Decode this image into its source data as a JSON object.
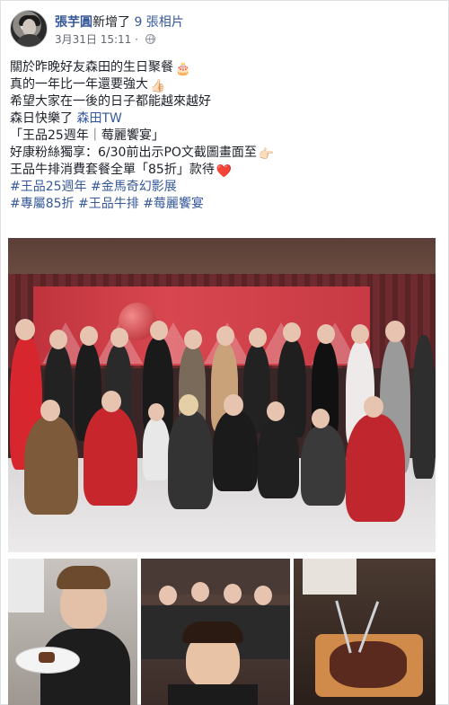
{
  "post": {
    "author": "張芋圓",
    "action": "新增了",
    "photo_count": "9 張相片",
    "timestamp": "3月31日 15:11",
    "separator": "·",
    "privacy_icon": "globe-icon"
  },
  "content": {
    "line1": "關於昨晚好友森田的生日聚餐",
    "line1_emoji": "🎂",
    "line2": "真的一年比一年還要強大",
    "line2_emoji": "👍🏻",
    "line3": "希望大家在一後的日子都能越來越好",
    "line4_prefix": "森日快樂了",
    "line4_link": "森田TW",
    "line5": "「王品25週年｜莓麗饗宴」",
    "line6": "好康粉絲獨享：6/30前出示PO文截圖畫面至",
    "line6_emoji": "👉🏻",
    "line7": "王品牛排消費套餐全單「85折」款待",
    "line7_emoji": "❤️",
    "tags_row1": [
      "#王品25週年",
      "#金馬奇幻影展"
    ],
    "tags_row2": [
      "#專屬85折",
      "#王品牛排",
      "#莓麗饗宴"
    ]
  },
  "colors": {
    "link": "#365899",
    "text": "#1d2129",
    "meta": "#616770"
  }
}
